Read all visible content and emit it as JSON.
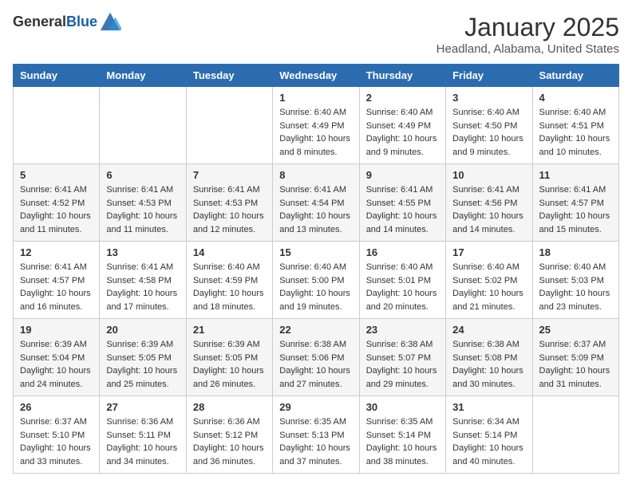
{
  "header": {
    "logo_general": "General",
    "logo_blue": "Blue",
    "title": "January 2025",
    "subtitle": "Headland, Alabama, United States"
  },
  "weekdays": [
    "Sunday",
    "Monday",
    "Tuesday",
    "Wednesday",
    "Thursday",
    "Friday",
    "Saturday"
  ],
  "weeks": [
    [
      {
        "day": "",
        "sunrise": "",
        "sunset": "",
        "daylight": ""
      },
      {
        "day": "",
        "sunrise": "",
        "sunset": "",
        "daylight": ""
      },
      {
        "day": "",
        "sunrise": "",
        "sunset": "",
        "daylight": ""
      },
      {
        "day": "1",
        "sunrise": "Sunrise: 6:40 AM",
        "sunset": "Sunset: 4:49 PM",
        "daylight": "Daylight: 10 hours and 8 minutes."
      },
      {
        "day": "2",
        "sunrise": "Sunrise: 6:40 AM",
        "sunset": "Sunset: 4:49 PM",
        "daylight": "Daylight: 10 hours and 9 minutes."
      },
      {
        "day": "3",
        "sunrise": "Sunrise: 6:40 AM",
        "sunset": "Sunset: 4:50 PM",
        "daylight": "Daylight: 10 hours and 9 minutes."
      },
      {
        "day": "4",
        "sunrise": "Sunrise: 6:40 AM",
        "sunset": "Sunset: 4:51 PM",
        "daylight": "Daylight: 10 hours and 10 minutes."
      }
    ],
    [
      {
        "day": "5",
        "sunrise": "Sunrise: 6:41 AM",
        "sunset": "Sunset: 4:52 PM",
        "daylight": "Daylight: 10 hours and 11 minutes."
      },
      {
        "day": "6",
        "sunrise": "Sunrise: 6:41 AM",
        "sunset": "Sunset: 4:53 PM",
        "daylight": "Daylight: 10 hours and 11 minutes."
      },
      {
        "day": "7",
        "sunrise": "Sunrise: 6:41 AM",
        "sunset": "Sunset: 4:53 PM",
        "daylight": "Daylight: 10 hours and 12 minutes."
      },
      {
        "day": "8",
        "sunrise": "Sunrise: 6:41 AM",
        "sunset": "Sunset: 4:54 PM",
        "daylight": "Daylight: 10 hours and 13 minutes."
      },
      {
        "day": "9",
        "sunrise": "Sunrise: 6:41 AM",
        "sunset": "Sunset: 4:55 PM",
        "daylight": "Daylight: 10 hours and 14 minutes."
      },
      {
        "day": "10",
        "sunrise": "Sunrise: 6:41 AM",
        "sunset": "Sunset: 4:56 PM",
        "daylight": "Daylight: 10 hours and 14 minutes."
      },
      {
        "day": "11",
        "sunrise": "Sunrise: 6:41 AM",
        "sunset": "Sunset: 4:57 PM",
        "daylight": "Daylight: 10 hours and 15 minutes."
      }
    ],
    [
      {
        "day": "12",
        "sunrise": "Sunrise: 6:41 AM",
        "sunset": "Sunset: 4:57 PM",
        "daylight": "Daylight: 10 hours and 16 minutes."
      },
      {
        "day": "13",
        "sunrise": "Sunrise: 6:41 AM",
        "sunset": "Sunset: 4:58 PM",
        "daylight": "Daylight: 10 hours and 17 minutes."
      },
      {
        "day": "14",
        "sunrise": "Sunrise: 6:40 AM",
        "sunset": "Sunset: 4:59 PM",
        "daylight": "Daylight: 10 hours and 18 minutes."
      },
      {
        "day": "15",
        "sunrise": "Sunrise: 6:40 AM",
        "sunset": "Sunset: 5:00 PM",
        "daylight": "Daylight: 10 hours and 19 minutes."
      },
      {
        "day": "16",
        "sunrise": "Sunrise: 6:40 AM",
        "sunset": "Sunset: 5:01 PM",
        "daylight": "Daylight: 10 hours and 20 minutes."
      },
      {
        "day": "17",
        "sunrise": "Sunrise: 6:40 AM",
        "sunset": "Sunset: 5:02 PM",
        "daylight": "Daylight: 10 hours and 21 minutes."
      },
      {
        "day": "18",
        "sunrise": "Sunrise: 6:40 AM",
        "sunset": "Sunset: 5:03 PM",
        "daylight": "Daylight: 10 hours and 23 minutes."
      }
    ],
    [
      {
        "day": "19",
        "sunrise": "Sunrise: 6:39 AM",
        "sunset": "Sunset: 5:04 PM",
        "daylight": "Daylight: 10 hours and 24 minutes."
      },
      {
        "day": "20",
        "sunrise": "Sunrise: 6:39 AM",
        "sunset": "Sunset: 5:05 PM",
        "daylight": "Daylight: 10 hours and 25 minutes."
      },
      {
        "day": "21",
        "sunrise": "Sunrise: 6:39 AM",
        "sunset": "Sunset: 5:05 PM",
        "daylight": "Daylight: 10 hours and 26 minutes."
      },
      {
        "day": "22",
        "sunrise": "Sunrise: 6:38 AM",
        "sunset": "Sunset: 5:06 PM",
        "daylight": "Daylight: 10 hours and 27 minutes."
      },
      {
        "day": "23",
        "sunrise": "Sunrise: 6:38 AM",
        "sunset": "Sunset: 5:07 PM",
        "daylight": "Daylight: 10 hours and 29 minutes."
      },
      {
        "day": "24",
        "sunrise": "Sunrise: 6:38 AM",
        "sunset": "Sunset: 5:08 PM",
        "daylight": "Daylight: 10 hours and 30 minutes."
      },
      {
        "day": "25",
        "sunrise": "Sunrise: 6:37 AM",
        "sunset": "Sunset: 5:09 PM",
        "daylight": "Daylight: 10 hours and 31 minutes."
      }
    ],
    [
      {
        "day": "26",
        "sunrise": "Sunrise: 6:37 AM",
        "sunset": "Sunset: 5:10 PM",
        "daylight": "Daylight: 10 hours and 33 minutes."
      },
      {
        "day": "27",
        "sunrise": "Sunrise: 6:36 AM",
        "sunset": "Sunset: 5:11 PM",
        "daylight": "Daylight: 10 hours and 34 minutes."
      },
      {
        "day": "28",
        "sunrise": "Sunrise: 6:36 AM",
        "sunset": "Sunset: 5:12 PM",
        "daylight": "Daylight: 10 hours and 36 minutes."
      },
      {
        "day": "29",
        "sunrise": "Sunrise: 6:35 AM",
        "sunset": "Sunset: 5:13 PM",
        "daylight": "Daylight: 10 hours and 37 minutes."
      },
      {
        "day": "30",
        "sunrise": "Sunrise: 6:35 AM",
        "sunset": "Sunset: 5:14 PM",
        "daylight": "Daylight: 10 hours and 38 minutes."
      },
      {
        "day": "31",
        "sunrise": "Sunrise: 6:34 AM",
        "sunset": "Sunset: 5:14 PM",
        "daylight": "Daylight: 10 hours and 40 minutes."
      },
      {
        "day": "",
        "sunrise": "",
        "sunset": "",
        "daylight": ""
      }
    ]
  ]
}
